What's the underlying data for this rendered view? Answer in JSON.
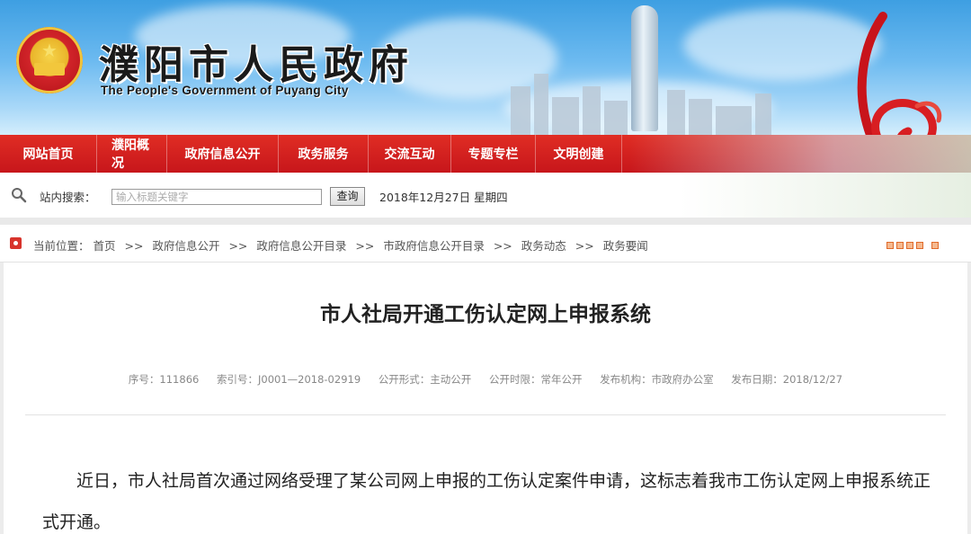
{
  "site": {
    "name": "濮阳市人民政府",
    "subtitle": "The People's Government of Puyang City"
  },
  "nav": {
    "items": [
      "网站首页",
      "濮阳概况",
      "政府信息公开",
      "政务服务",
      "交流互动",
      "专题专栏",
      "文明创建"
    ]
  },
  "search": {
    "label": "站内搜索：",
    "placeholder": "输入标题关键字",
    "button": "查询",
    "date": "2018年12月27日  星期四"
  },
  "breadcrumb": {
    "prefix": "当前位置：",
    "items": [
      "首页",
      "政府信息公开",
      "政府信息公开目录",
      "市政府信息公开目录",
      "政务动态",
      "政务要闻"
    ],
    "separator": ">>"
  },
  "article": {
    "title": "市人社局开通工伤认定网上申报系统",
    "meta": {
      "serial": "序号：111866",
      "index": "索引号：J0001—2018-02919",
      "form": "公开形式：主动公开",
      "period": "公开时限：常年公开",
      "publisher": "发布机构：市政府办公室",
      "date": "发布日期：2018/12/27"
    },
    "body": "近日，市人社局首次通过网络受理了某公司网上申报的工伤认定案件申请，这标志着我市工伤认定网上申报系统正式开通。"
  },
  "colors": {
    "nav_red": "#d2201f",
    "accent_orange": "#e06a2a"
  }
}
